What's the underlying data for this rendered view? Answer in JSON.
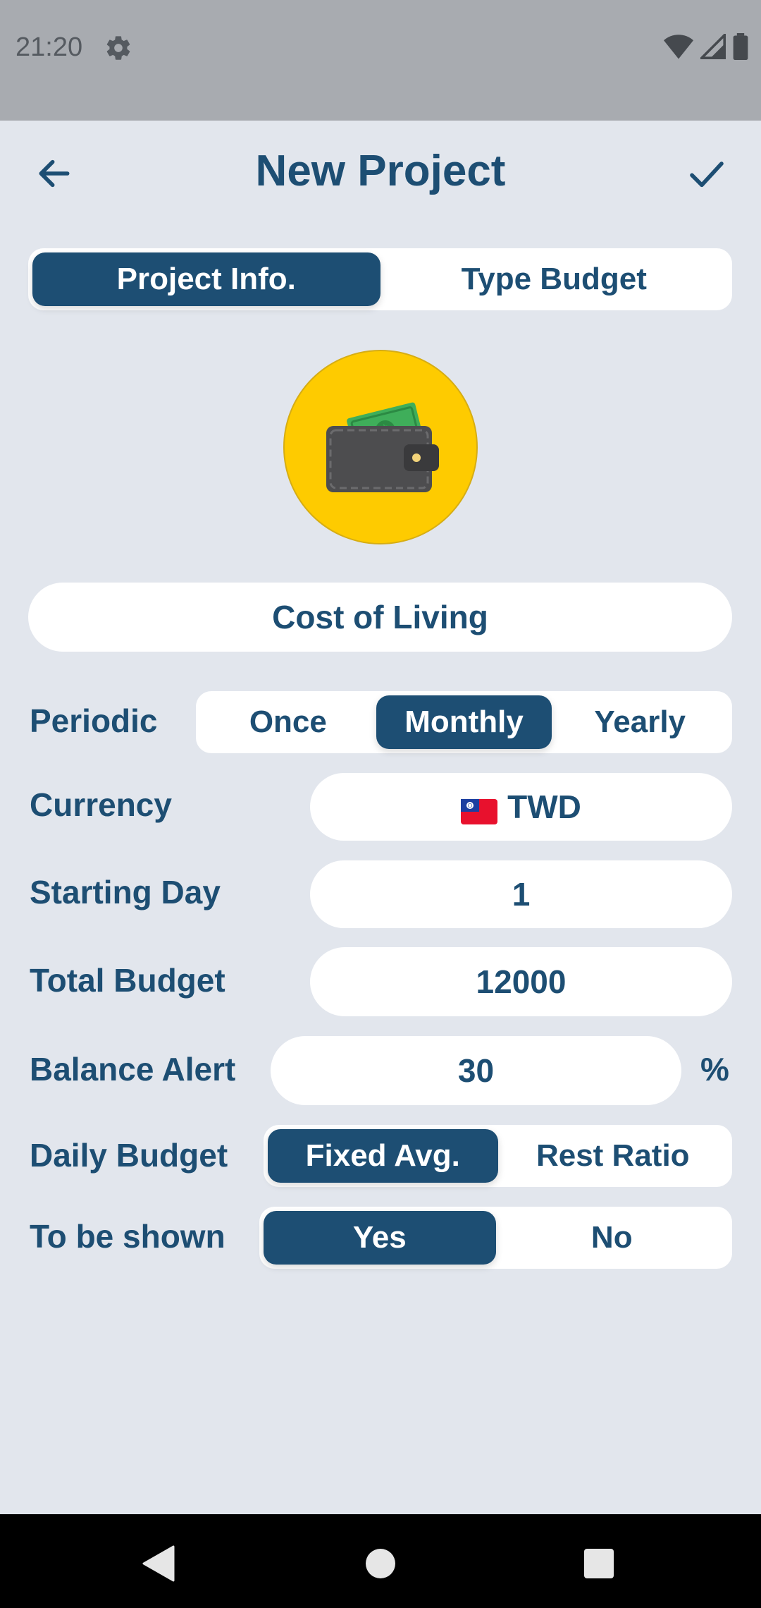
{
  "status_bar": {
    "time": "21:20",
    "icons": [
      "gear-icon",
      "wifi-icon",
      "signal-icon",
      "battery-icon"
    ]
  },
  "header": {
    "title": "New Project",
    "back_icon": "arrow-left-icon",
    "confirm_icon": "check-icon"
  },
  "tabs": [
    {
      "label": "Project Info.",
      "active": true
    },
    {
      "label": "Type Budget",
      "active": false
    }
  ],
  "project": {
    "icon": "wallet-icon",
    "icon_bg_color": "#fecb00",
    "name": "Cost of Living"
  },
  "form": {
    "periodic": {
      "label": "Periodic",
      "options": [
        "Once",
        "Monthly",
        "Yearly"
      ],
      "selected": "Monthly"
    },
    "currency": {
      "label": "Currency",
      "flag_icon": "taiwan-flag-icon",
      "value": "TWD"
    },
    "starting_day": {
      "label": "Starting Day",
      "value": "1"
    },
    "total_budget": {
      "label": "Total Budget",
      "value": "12000"
    },
    "balance_alert": {
      "label": "Balance Alert",
      "value": "30",
      "unit": "%"
    },
    "daily_budget": {
      "label": "Daily Budget",
      "options": [
        "Fixed Avg.",
        "Rest Ratio"
      ],
      "selected": "Fixed Avg."
    },
    "to_be_shown": {
      "label": "To be shown",
      "options": [
        "Yes",
        "No"
      ],
      "selected": "Yes"
    }
  },
  "nav_bar": {
    "icons": [
      "back-triangle-icon",
      "home-circle-icon",
      "recents-square-icon"
    ]
  },
  "colors": {
    "primary": "#1d4e73",
    "background": "#e2e6ed",
    "surface": "#ffffff",
    "accent": "#fecb00"
  }
}
